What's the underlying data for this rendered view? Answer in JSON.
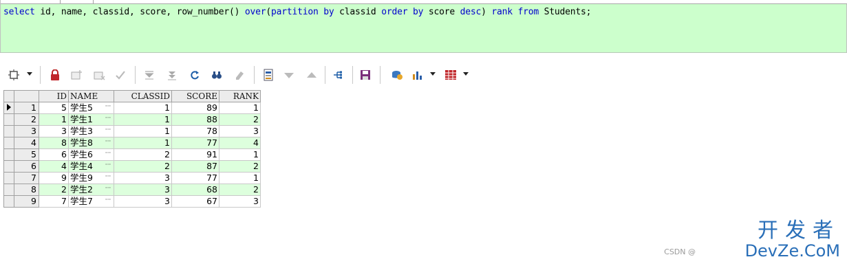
{
  "sql": {
    "text_parts": [
      {
        "t": "select",
        "k": true
      },
      {
        "t": " id, name, classid, score, ",
        "k": false
      },
      {
        "t": "row_number",
        "k": false
      },
      {
        "t": "() ",
        "k": false
      },
      {
        "t": "over",
        "k": true
      },
      {
        "t": "(",
        "k": false
      },
      {
        "t": "partition by",
        "k": true
      },
      {
        "t": " classid ",
        "k": false
      },
      {
        "t": "order by",
        "k": true
      },
      {
        "t": " score ",
        "k": false
      },
      {
        "t": "desc",
        "k": true
      },
      {
        "t": ") ",
        "k": false
      },
      {
        "t": "rank",
        "k": true
      },
      {
        "t": " ",
        "k": false
      },
      {
        "t": "from",
        "k": true
      },
      {
        "t": " Students;",
        "k": false
      }
    ]
  },
  "toolbar": {
    "icons": [
      "grid-options-icon",
      "lock-icon",
      "insert-record-icon",
      "delete-record-icon",
      "post-changes-icon",
      "next-page-icon",
      "last-page-icon",
      "refresh-icon",
      "find-icon",
      "clear-icon",
      "single-record-view-icon",
      "sort-descending-icon",
      "sort-ascending-icon",
      "query-by-example-icon",
      "save-icon",
      "connect-icon",
      "chart-icon",
      "export-icon"
    ]
  },
  "grid": {
    "columns": [
      "ID",
      "NAME",
      "CLASSID",
      "SCORE",
      "RANK"
    ],
    "rows": [
      {
        "n": "1",
        "id": "5",
        "name": "学生5",
        "classid": "1",
        "score": "89",
        "rank": "1"
      },
      {
        "n": "2",
        "id": "1",
        "name": "学生1",
        "classid": "1",
        "score": "88",
        "rank": "2"
      },
      {
        "n": "3",
        "id": "3",
        "name": "学生3",
        "classid": "1",
        "score": "78",
        "rank": "3"
      },
      {
        "n": "4",
        "id": "8",
        "name": "学生8",
        "classid": "1",
        "score": "77",
        "rank": "4"
      },
      {
        "n": "5",
        "id": "6",
        "name": "学生6",
        "classid": "2",
        "score": "91",
        "rank": "1"
      },
      {
        "n": "6",
        "id": "4",
        "name": "学生4",
        "classid": "2",
        "score": "87",
        "rank": "2"
      },
      {
        "n": "7",
        "id": "9",
        "name": "学生9",
        "classid": "3",
        "score": "77",
        "rank": "1"
      },
      {
        "n": "8",
        "id": "2",
        "name": "学生2",
        "classid": "3",
        "score": "68",
        "rank": "2"
      },
      {
        "n": "9",
        "id": "7",
        "name": "学生7",
        "classid": "3",
        "score": "67",
        "rank": "3"
      }
    ],
    "ellipsis": "···"
  },
  "watermark": {
    "title": "开发者",
    "sub": "CSDN @",
    "domain": "DevZe.CoM"
  },
  "colors": {
    "editor_bg": "#ccffcc",
    "keyword": "#0000cc",
    "row_alt": "#ddffdd",
    "watermark": "#2a6fb8"
  }
}
